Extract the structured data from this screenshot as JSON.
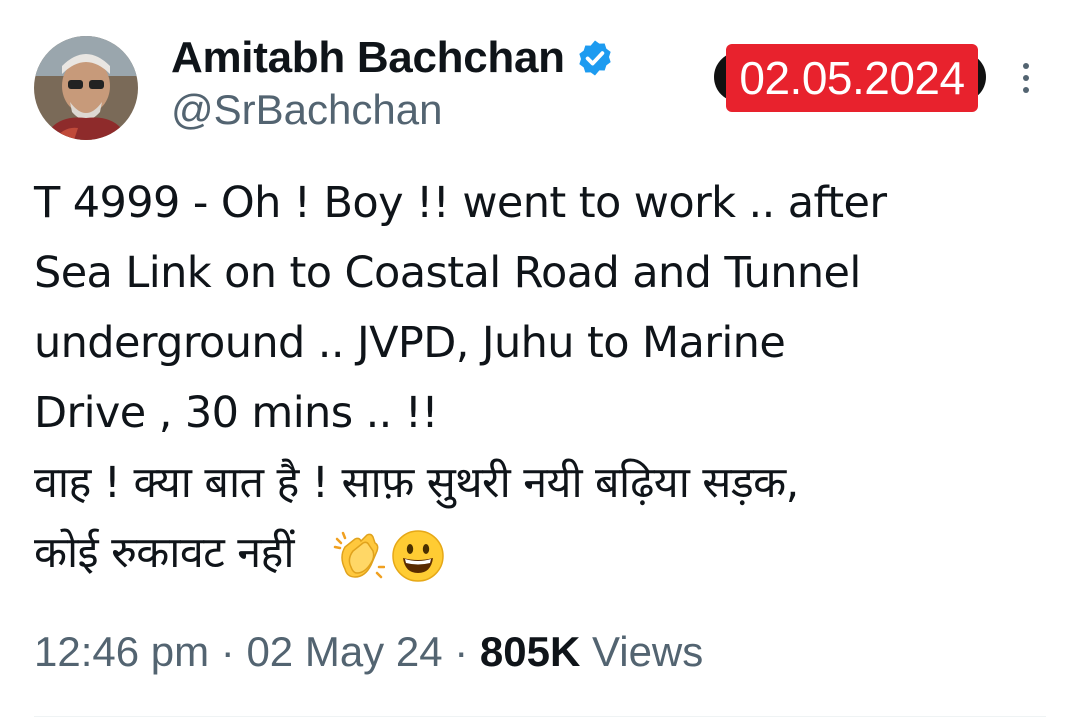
{
  "user": {
    "display_name": "Amitabh Bachchan",
    "handle": "@SrBachchan",
    "verified_icon": "verified-badge-icon"
  },
  "date_stamp": "02.05.2024",
  "tweet": {
    "lines": [
      "T 4999 - Oh ! Boy !! went to work .. after",
      "Sea Link on to Coastal Road and Tunnel",
      "underground .. JVPD, Juhu to Marine",
      "Drive , 30 mins .. !!",
      "वाह ! क्या बात है  ! साफ़ सुथरी  नयी बढ़िया सड़क,",
      "कोई रुकावट नहीं"
    ],
    "emojis": [
      "clapping-hands",
      "grinning-face"
    ]
  },
  "meta": {
    "time": "12:46 pm",
    "sep1": " · ",
    "date": "02 May 24",
    "sep2": " · ",
    "views_count": "805K",
    "views_label": " Views"
  },
  "colors": {
    "text": "#0f1419",
    "secondary": "#536471",
    "verified": "#1d9bf0",
    "stamp": "#e8222d"
  }
}
